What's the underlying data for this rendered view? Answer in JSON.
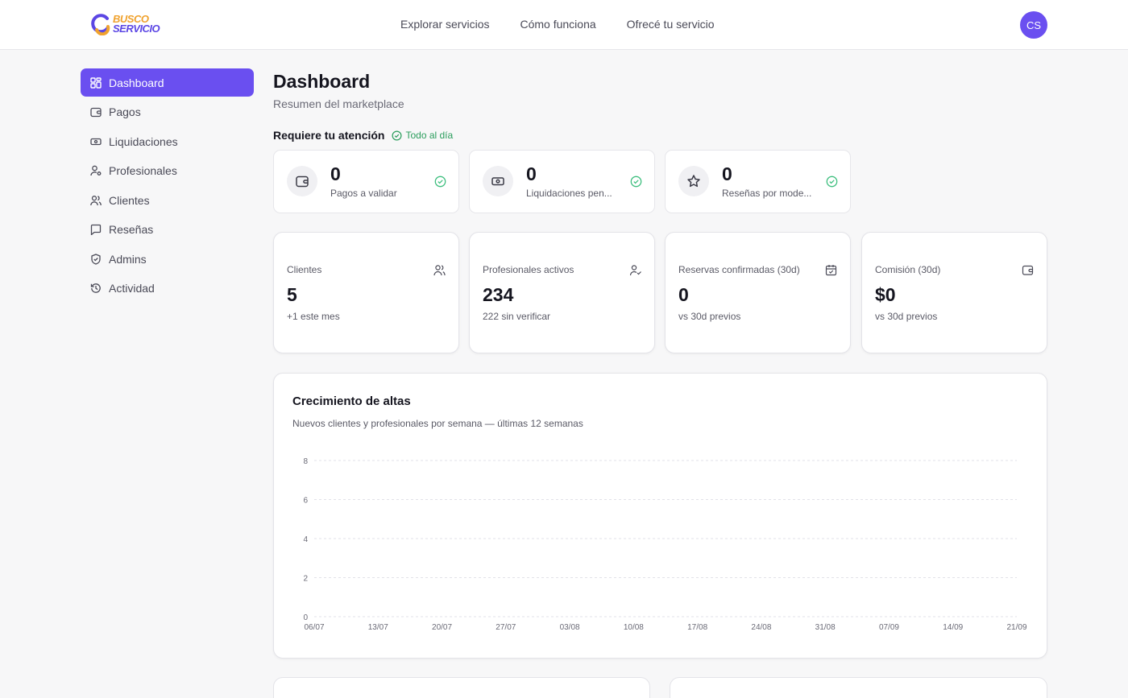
{
  "brand": {
    "line1": "BUSCO",
    "line2": "SERVICIO"
  },
  "nav": [
    "Explorar servicios",
    "Cómo funciona",
    "Ofrecé tu servicio"
  ],
  "user": {
    "initials": "CS"
  },
  "sidebar": {
    "items": [
      {
        "label": "Dashboard",
        "icon": "grid-icon",
        "active": true
      },
      {
        "label": "Pagos",
        "icon": "wallet-icon"
      },
      {
        "label": "Liquidaciones",
        "icon": "banknote-icon"
      },
      {
        "label": "Profesionales",
        "icon": "user-gear-icon"
      },
      {
        "label": "Clientes",
        "icon": "users-icon"
      },
      {
        "label": "Reseñas",
        "icon": "message-icon"
      },
      {
        "label": "Admins",
        "icon": "shield-icon"
      },
      {
        "label": "Actividad",
        "icon": "history-icon"
      }
    ]
  },
  "header": {
    "title": "Dashboard",
    "subtitle": "Resumen del marketplace"
  },
  "attention": {
    "title": "Requiere tu atención",
    "status": "Todo al día",
    "cards": [
      {
        "value": "0",
        "label": "Pagos a validar",
        "icon": "wallet-icon"
      },
      {
        "value": "0",
        "label": "Liquidaciones pen...",
        "icon": "banknote-icon"
      },
      {
        "value": "0",
        "label": "Reseñas por mode...",
        "icon": "star-icon"
      }
    ]
  },
  "stats": [
    {
      "label": "Clientes",
      "value": "5",
      "sub": "+1 este mes",
      "icon": "users-icon"
    },
    {
      "label": "Profesionales activos",
      "value": "234",
      "sub": "222 sin verificar",
      "icon": "user-check-icon"
    },
    {
      "label": "Reservas confirmadas (30d)",
      "value": "0",
      "sub": "vs 30d previos",
      "icon": "calendar-check-icon"
    },
    {
      "label": "Comisión (30d)",
      "value": "$0",
      "sub": "vs 30d previos",
      "icon": "wallet-icon"
    }
  ],
  "growth": {
    "title": "Crecimiento de altas",
    "subtitle": "Nuevos clientes y profesionales por semana — últimas 12 semanas"
  },
  "colors": {
    "accent": "#6a4ff0",
    "success": "#2a9d5c",
    "logo_orange": "#f0a22e",
    "logo_purple": "#5b46e4"
  },
  "chart_data": {
    "type": "line",
    "title": "Crecimiento de altas",
    "subtitle": "Nuevos clientes y profesionales por semana — últimas 12 semanas",
    "categories": [
      "06/07",
      "13/07",
      "20/07",
      "27/07",
      "03/08",
      "10/08",
      "17/08",
      "24/08",
      "31/08",
      "07/09",
      "14/09",
      "21/09"
    ],
    "yticks": [
      "0",
      "2",
      "4",
      "6",
      "8"
    ],
    "ylim": [
      0,
      8
    ],
    "series": [],
    "grid": true
  }
}
